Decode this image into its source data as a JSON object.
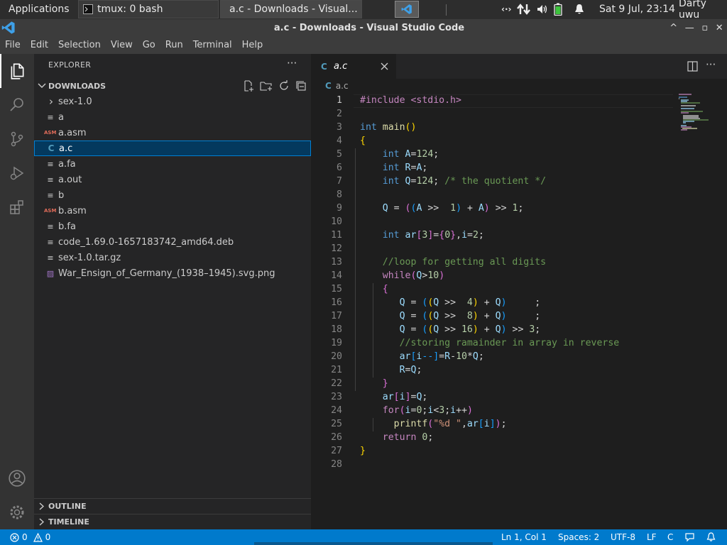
{
  "taskbar": {
    "applications": "Applications",
    "apps_sep": "⋮",
    "windows": [
      {
        "label": "tmux: 0 bash"
      },
      {
        "label": "a.c - Downloads - Visual..."
      }
    ],
    "datetime": "Sat  9 Jul, 23:14",
    "user": "Darty uwu"
  },
  "window": {
    "title": "a.c - Downloads - Visual Studio Code",
    "controls": {
      "keep_above": "^",
      "minimize": "—",
      "maximize": "▫",
      "close": "✕"
    }
  },
  "menu": [
    "File",
    "Edit",
    "Selection",
    "View",
    "Go",
    "Run",
    "Terminal",
    "Help"
  ],
  "explorer": {
    "header": "EXPLORER",
    "more": "···",
    "folder": "DOWNLOADS",
    "files": [
      {
        "name": "sex-1.0",
        "icon": "folder-chevron-icon",
        "glyph": "›"
      },
      {
        "name": "a",
        "icon": "file-lines-icon",
        "glyph": "≡"
      },
      {
        "name": "a.asm",
        "icon": "asm-file-icon",
        "glyph": "ASM"
      },
      {
        "name": "a.c",
        "icon": "c-file-icon",
        "glyph": "C"
      },
      {
        "name": "a.fa",
        "icon": "file-lines-icon",
        "glyph": "≡"
      },
      {
        "name": "a.out",
        "icon": "file-lines-icon",
        "glyph": "≡"
      },
      {
        "name": "b",
        "icon": "file-lines-icon",
        "glyph": "≡"
      },
      {
        "name": "b.asm",
        "icon": "asm-file-icon",
        "glyph": "ASM"
      },
      {
        "name": "b.fa",
        "icon": "file-lines-icon",
        "glyph": "≡"
      },
      {
        "name": "code_1.69.0-1657183742_amd64.deb",
        "icon": "file-lines-icon",
        "glyph": "≡"
      },
      {
        "name": "sex-1.0.tar.gz",
        "icon": "file-lines-icon",
        "glyph": "≡"
      },
      {
        "name": "War_Ensign_of_Germany_(1938–1945).svg.png",
        "icon": "image-file-icon",
        "glyph": "▨"
      }
    ],
    "selected": "a.c",
    "outline": "OUTLINE",
    "timeline": "TIMELINE"
  },
  "editor": {
    "tab_label": "a.c",
    "tab_icon": "C",
    "breadcrumb": "a.c",
    "current_line": "1",
    "line_numbers": [
      "1",
      "2",
      "3",
      "4",
      "5",
      "6",
      "7",
      "8",
      "9",
      "10",
      "11",
      "12",
      "13",
      "14",
      "15",
      "16",
      "17",
      "18",
      "19",
      "20",
      "21",
      "22",
      "23",
      "24",
      "25",
      "26",
      "27",
      "28"
    ],
    "tokens": [
      [
        [
          "#include <stdio.h>",
          "ctl"
        ]
      ],
      [],
      [
        [
          "int",
          "kw"
        ],
        [
          " "
        ],
        [
          "main",
          "fn"
        ],
        [
          "()",
          "br1"
        ]
      ],
      [
        [
          "{",
          "br1"
        ]
      ],
      [
        [
          "    "
        ],
        [
          "int",
          "kw"
        ],
        [
          " "
        ],
        [
          "A",
          "var"
        ],
        [
          "="
        ],
        [
          "124",
          "num"
        ],
        [
          ";"
        ]
      ],
      [
        [
          "    "
        ],
        [
          "int",
          "kw"
        ],
        [
          " "
        ],
        [
          "R",
          "var"
        ],
        [
          "="
        ],
        [
          "A",
          "var"
        ],
        [
          ";"
        ]
      ],
      [
        [
          "    "
        ],
        [
          "int",
          "kw"
        ],
        [
          " "
        ],
        [
          "Q",
          "var"
        ],
        [
          "="
        ],
        [
          "124",
          "num"
        ],
        [
          "; "
        ],
        [
          "/* the quotient */",
          "cmt"
        ]
      ],
      [],
      [
        [
          "    "
        ],
        [
          "Q",
          "var"
        ],
        [
          " = "
        ],
        [
          "(",
          "br2"
        ],
        [
          "(",
          "br3"
        ],
        [
          "A",
          "var"
        ],
        [
          " >>  "
        ],
        [
          "1",
          "num"
        ],
        [
          ")",
          "br3"
        ],
        [
          " + "
        ],
        [
          "A",
          "var"
        ],
        [
          ")",
          "br2"
        ],
        [
          " >> "
        ],
        [
          "1",
          "num"
        ],
        [
          ";"
        ]
      ],
      [],
      [
        [
          "    "
        ],
        [
          "int",
          "kw"
        ],
        [
          " "
        ],
        [
          "ar",
          "var"
        ],
        [
          "[",
          "br2"
        ],
        [
          "3",
          "num"
        ],
        [
          "]",
          "br2"
        ],
        [
          "="
        ],
        [
          "{",
          "br2"
        ],
        [
          "0",
          "num"
        ],
        [
          "}",
          "br2"
        ],
        [
          ","
        ],
        [
          "i",
          "var"
        ],
        [
          "="
        ],
        [
          "2",
          "num"
        ],
        [
          ";"
        ]
      ],
      [],
      [
        [
          "    "
        ],
        [
          "//loop for getting all digits",
          "cmt"
        ]
      ],
      [
        [
          "    "
        ],
        [
          "while",
          "ctl"
        ],
        [
          "(",
          "br2"
        ],
        [
          "Q",
          "var"
        ],
        [
          ">"
        ],
        [
          "10",
          "num"
        ],
        [
          ")",
          "br2"
        ]
      ],
      [
        [
          "    "
        ],
        [
          "{",
          "br2"
        ]
      ],
      [
        [
          "       "
        ],
        [
          "Q",
          "var"
        ],
        [
          " = "
        ],
        [
          "(",
          "br3"
        ],
        [
          "(",
          "br1"
        ],
        [
          "Q",
          "var"
        ],
        [
          " >>  "
        ],
        [
          "4",
          "num"
        ],
        [
          ")",
          "br1"
        ],
        [
          " + "
        ],
        [
          "Q",
          "var"
        ],
        [
          ")",
          "br3"
        ],
        [
          "     ;"
        ]
      ],
      [
        [
          "       "
        ],
        [
          "Q",
          "var"
        ],
        [
          " = "
        ],
        [
          "(",
          "br3"
        ],
        [
          "(",
          "br1"
        ],
        [
          "Q",
          "var"
        ],
        [
          " >>  "
        ],
        [
          "8",
          "num"
        ],
        [
          ")",
          "br1"
        ],
        [
          " + "
        ],
        [
          "Q",
          "var"
        ],
        [
          ")",
          "br3"
        ],
        [
          "     ;"
        ]
      ],
      [
        [
          "       "
        ],
        [
          "Q",
          "var"
        ],
        [
          " = "
        ],
        [
          "(",
          "br3"
        ],
        [
          "(",
          "br1"
        ],
        [
          "Q",
          "var"
        ],
        [
          " >> "
        ],
        [
          "16",
          "num"
        ],
        [
          ")",
          "br1"
        ],
        [
          " + "
        ],
        [
          "Q",
          "var"
        ],
        [
          ")",
          "br3"
        ],
        [
          " >> "
        ],
        [
          "3",
          "num"
        ],
        [
          ";"
        ]
      ],
      [
        [
          "       "
        ],
        [
          "//storing ramainder in array in reverse",
          "cmt"
        ]
      ],
      [
        [
          "       "
        ],
        [
          "ar",
          "var"
        ],
        [
          "[",
          "br3"
        ],
        [
          "i",
          "var"
        ],
        [
          "--",
          "br3"
        ],
        [
          "]",
          "br3"
        ],
        [
          "="
        ],
        [
          "R",
          "var"
        ],
        [
          "-"
        ],
        [
          "10",
          "num"
        ],
        [
          "*"
        ],
        [
          "Q",
          "var"
        ],
        [
          ";"
        ]
      ],
      [
        [
          "       "
        ],
        [
          "R",
          "var"
        ],
        [
          "="
        ],
        [
          "Q",
          "var"
        ],
        [
          ";"
        ]
      ],
      [
        [
          "    "
        ],
        [
          "}",
          "br2"
        ]
      ],
      [
        [
          "    "
        ],
        [
          "ar",
          "var"
        ],
        [
          "[",
          "br2"
        ],
        [
          "i",
          "var"
        ],
        [
          "]",
          "br2"
        ],
        [
          "="
        ],
        [
          "Q",
          "var"
        ],
        [
          ";"
        ]
      ],
      [
        [
          "    "
        ],
        [
          "for",
          "ctl"
        ],
        [
          "(",
          "br2"
        ],
        [
          "i",
          "var"
        ],
        [
          "="
        ],
        [
          "0",
          "num"
        ],
        [
          ";"
        ],
        [
          "i",
          "var"
        ],
        [
          "<"
        ],
        [
          "3",
          "num"
        ],
        [
          ";"
        ],
        [
          "i",
          "var"
        ],
        [
          "++"
        ],
        [
          ")",
          "br2"
        ]
      ],
      [
        [
          "      "
        ],
        [
          "printf",
          "fn"
        ],
        [
          "(",
          "br2"
        ],
        [
          "\"%d \"",
          "str"
        ],
        [
          ","
        ],
        [
          "ar",
          "var"
        ],
        [
          "[",
          "br3"
        ],
        [
          "i",
          "var"
        ],
        [
          "]",
          "br3"
        ],
        [
          ")",
          "br2"
        ],
        [
          ";"
        ]
      ],
      [
        [
          "    "
        ],
        [
          "return",
          "ctl"
        ],
        [
          " "
        ],
        [
          "0",
          "num"
        ],
        [
          ";"
        ]
      ],
      [
        [
          "}",
          "br1"
        ]
      ],
      []
    ]
  },
  "statusbar": {
    "errors": "0",
    "warnings": "0",
    "position": "Ln 1, Col 1",
    "spaces": "Spaces: 2",
    "encoding": "UTF-8",
    "eol": "LF",
    "language": "C"
  }
}
